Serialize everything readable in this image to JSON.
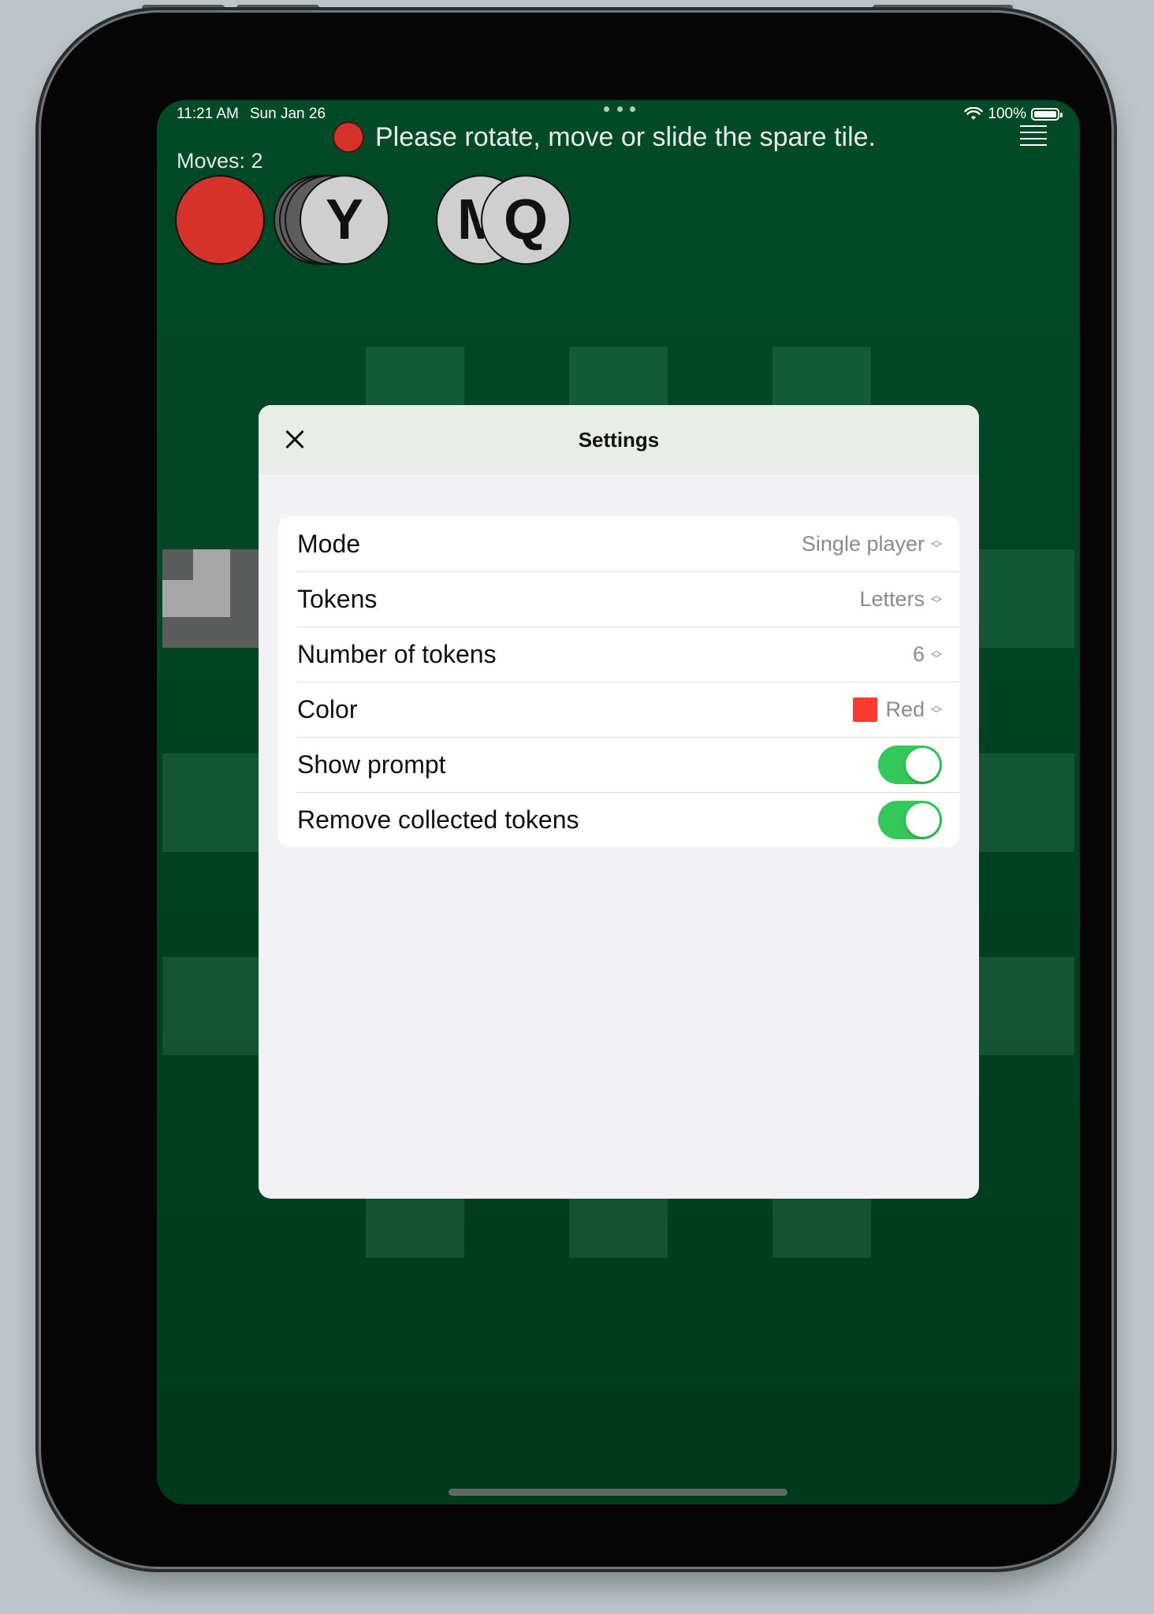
{
  "status_bar": {
    "time": "11:21 AM",
    "date": "Sun Jan 26",
    "battery": "100%"
  },
  "game": {
    "prompt": "Please rotate, move or slide the spare tile.",
    "moves": "Moves: 2",
    "tokens": [
      {
        "letter": "",
        "color": "#d4322a"
      },
      {
        "letter": "Y",
        "color": "#cfcfcf"
      },
      {
        "letter": "M",
        "color": "#cfcfcf"
      },
      {
        "letter": "Q",
        "color": "#cfcfcf"
      }
    ],
    "player_color": "#d4322a"
  },
  "settings": {
    "title": "Settings",
    "rows": [
      {
        "label": "Mode",
        "value": "Single player",
        "type": "picker"
      },
      {
        "label": "Tokens",
        "value": "Letters",
        "type": "picker"
      },
      {
        "label": "Number of tokens",
        "value": "6",
        "type": "picker"
      },
      {
        "label": "Color",
        "value": "Red",
        "type": "picker",
        "swatch": "#ff3b30"
      },
      {
        "label": "Show prompt",
        "type": "toggle",
        "on": true
      },
      {
        "label": "Remove collected tokens",
        "type": "toggle",
        "on": true
      }
    ],
    "toggle_on_color": "#34c759"
  }
}
